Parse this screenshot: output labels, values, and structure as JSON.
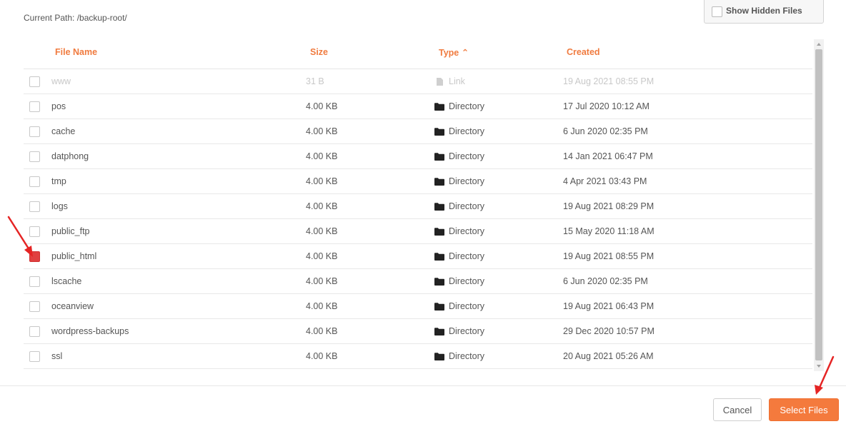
{
  "current_path": "Current Path: /backup-root/",
  "show_hidden_label": "Show Hidden Files",
  "columns": {
    "name": "File Name",
    "size": "Size",
    "type": "Type ⌃",
    "created": "Created"
  },
  "rows": [
    {
      "name": "www",
      "size": "31 B",
      "type": "Link",
      "created": "19 Aug 2021 08:55 PM",
      "icon": "file-link-icon",
      "muted": true,
      "checked": false
    },
    {
      "name": "pos",
      "size": "4.00 KB",
      "type": "Directory",
      "created": "17 Jul 2020 10:12 AM",
      "icon": "folder-icon",
      "muted": false,
      "checked": false
    },
    {
      "name": "cache",
      "size": "4.00 KB",
      "type": "Directory",
      "created": "6 Jun 2020 02:35 PM",
      "icon": "folder-icon",
      "muted": false,
      "checked": false
    },
    {
      "name": "datphong",
      "size": "4.00 KB",
      "type": "Directory",
      "created": "14 Jan 2021 06:47 PM",
      "icon": "folder-icon",
      "muted": false,
      "checked": false
    },
    {
      "name": "tmp",
      "size": "4.00 KB",
      "type": "Directory",
      "created": "4 Apr 2021 03:43 PM",
      "icon": "folder-icon",
      "muted": false,
      "checked": false
    },
    {
      "name": "logs",
      "size": "4.00 KB",
      "type": "Directory",
      "created": "19 Aug 2021 08:29 PM",
      "icon": "folder-icon",
      "muted": false,
      "checked": false
    },
    {
      "name": "public_ftp",
      "size": "4.00 KB",
      "type": "Directory",
      "created": "15 May 2020 11:18 AM",
      "icon": "folder-icon",
      "muted": false,
      "checked": false
    },
    {
      "name": "public_html",
      "size": "4.00 KB",
      "type": "Directory",
      "created": "19 Aug 2021 08:55 PM",
      "icon": "folder-icon",
      "muted": false,
      "checked": true
    },
    {
      "name": "lscache",
      "size": "4.00 KB",
      "type": "Directory",
      "created": "6 Jun 2020 02:35 PM",
      "icon": "folder-icon",
      "muted": false,
      "checked": false
    },
    {
      "name": "oceanview",
      "size": "4.00 KB",
      "type": "Directory",
      "created": "19 Aug 2021 06:43 PM",
      "icon": "folder-icon",
      "muted": false,
      "checked": false
    },
    {
      "name": "wordpress-backups",
      "size": "4.00 KB",
      "type": "Directory",
      "created": "29 Dec 2020 10:57 PM",
      "icon": "folder-icon",
      "muted": false,
      "checked": false
    },
    {
      "name": "ssl",
      "size": "4.00 KB",
      "type": "Directory",
      "created": "20 Aug 2021 05:26 AM",
      "icon": "folder-icon",
      "muted": false,
      "checked": false
    }
  ],
  "buttons": {
    "cancel": "Cancel",
    "select": "Select Files"
  },
  "colors": {
    "accent": "#f47a3d",
    "header_text": "#f07b3f",
    "annotation_arrow": "#e52424",
    "checked_box": "#e04040"
  }
}
